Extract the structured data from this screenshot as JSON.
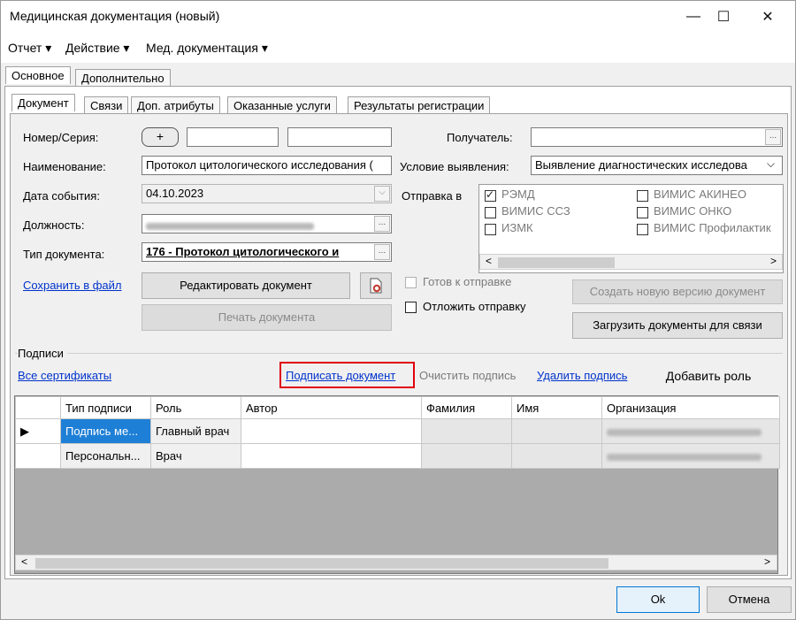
{
  "window": {
    "title": "Медицинская документация (новый)",
    "min": "—",
    "max": "☐",
    "close": "✕"
  },
  "menu": [
    "Отчет ▾",
    "Действие ▾",
    "Мед. документация ▾"
  ],
  "outer_tabs": [
    "Основное",
    "Дополнительно"
  ],
  "inner_tabs": [
    "Документ",
    "Связи",
    "Доп. атрибуты",
    "Оказанные услуги",
    "Результаты регистрации"
  ],
  "form": {
    "number_label": "Номер/Серия:",
    "plus": "+",
    "name_label": "Наименование:",
    "name_value": "Протокол цитологического исследования (",
    "event_date_label": "Дата события:",
    "event_date_value": "04.10.2023",
    "position_label": "Должность:",
    "doctype_label": "Тип документа:",
    "doctype_value": "176 - Протокол цитологического и",
    "recipient_label": "Получатель:",
    "detection_label": "Условие выявления:",
    "detection_value": "Выявление диагностических исследова",
    "send_label": "Отправка в",
    "send_options": [
      "РЭМД",
      "ВИМИС АКИНЕО",
      "ВИМИС ССЗ",
      "ВИМИС ОНКО",
      "ИЗМК",
      "ВИМИС Профилактик"
    ],
    "ellipsis": "...",
    "dropdown": "⌵"
  },
  "actions": {
    "save_to_file": "Сохранить в файл",
    "edit_document": "Редактировать документ",
    "print_document": "Печать документа",
    "ready_to_send": "Готов к отправке",
    "postpone_send": "Отложить отправку",
    "new_version": "Создать новую версию документ",
    "load_documents": "Загрузить документы для связи"
  },
  "signatures": {
    "section_label": "Подписи",
    "all_certs": "Все сертификаты",
    "sign_document": "Подписать документ",
    "clear_signature": "Очистить подпись",
    "delete_signature": "Удалить подпись",
    "add_role": "Добавить роль",
    "columns": [
      "Тип подписи",
      "Роль",
      "Автор",
      "Фамилия",
      "Имя",
      "Организация"
    ],
    "rows": [
      {
        "marker": "▶",
        "type": "Подпись ме...",
        "role": "Главный врач"
      },
      {
        "marker": "",
        "type": "Персональн...",
        "role": "Врач"
      }
    ]
  },
  "footer": {
    "ok": "Ok",
    "cancel": "Отмена"
  },
  "colors": {
    "highlight": "#e0000f",
    "selection": "#1e7fd6",
    "link": "#0033cc"
  }
}
